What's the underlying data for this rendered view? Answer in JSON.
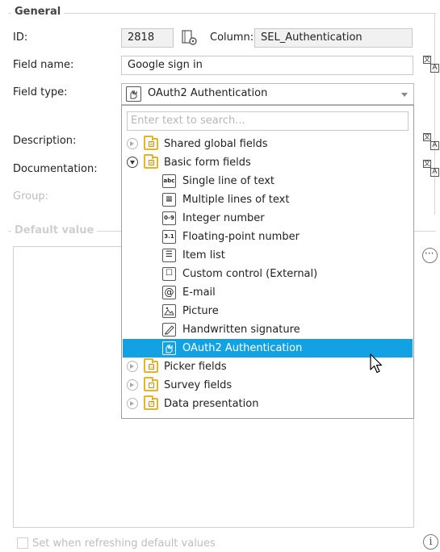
{
  "general": {
    "legend": "General",
    "id_label": "ID:",
    "id_value": "2818",
    "column_label": "Column:",
    "column_value": "SEL_Authentication",
    "field_name_label": "Field name:",
    "field_name_value": "Google sign in",
    "field_type_label": "Field type:",
    "field_type_value": "OAuth2 Authentication",
    "description_label": "Description:",
    "documentation_label": "Documentation:",
    "group_label": "Group:"
  },
  "dropdown": {
    "search_placeholder": "Enter text to search...",
    "items": [
      {
        "label": "Shared global fields",
        "kind": "folder"
      },
      {
        "label": "Basic form fields",
        "kind": "folder-open"
      },
      {
        "label": "Single line of text",
        "icon": "abc"
      },
      {
        "label": "Multiple lines of text",
        "icon": "lines"
      },
      {
        "label": "Integer number",
        "icon": "0-9"
      },
      {
        "label": "Floating-point number",
        "icon": "3.1"
      },
      {
        "label": "Item list",
        "icon": "list"
      },
      {
        "label": "Custom control (External)",
        "icon": "custom"
      },
      {
        "label": "E-mail",
        "icon": "@"
      },
      {
        "label": "Picture",
        "icon": "picture"
      },
      {
        "label": "Handwritten signature",
        "icon": "signature"
      },
      {
        "label": "OAuth2 Authentication",
        "icon": "oauth",
        "selected": true
      },
      {
        "label": "Picker fields",
        "kind": "folder"
      },
      {
        "label": "Survey fields",
        "kind": "folder"
      },
      {
        "label": "Data presentation",
        "kind": "folder"
      }
    ]
  },
  "default_value": {
    "legend": "Default value",
    "checkbox_label": "Set when refreshing default values"
  },
  "colors": {
    "selection": "#12a1e3",
    "folder": "#e5b42a"
  }
}
